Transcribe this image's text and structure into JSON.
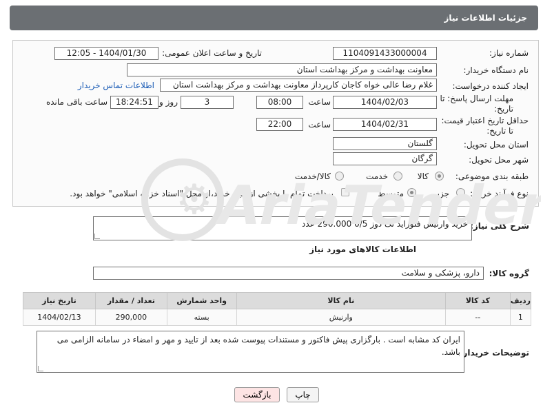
{
  "header": {
    "title": "جزئیات اطلاعات نیاز"
  },
  "form": {
    "need_number_label": "شماره نیاز:",
    "need_number": "1104091433000004",
    "announce_label": "تاریخ و ساعت اعلان عمومی:",
    "announce_value": "1404/01/30 - 12:05",
    "buyer_org_label": "نام دستگاه خریدار:",
    "buyer_org": "معاونت  بهداشت و مرکز بهداشت استان",
    "requester_label": "ایجاد کننده درخواست:",
    "requester": "غلام رضا عالی خواه کاجان کارپرداز معاونت  بهداشت و مرکز بهداشت استان",
    "buyer_contact_link": "اطلاعات تماس خریدار",
    "deadline_label_1": "مهلت ارسال پاسخ: تا",
    "deadline_label_2": "تاریخ:",
    "deadline_date": "1404/02/03",
    "time_label": "ساعت",
    "deadline_time": "08:00",
    "days_value": "3",
    "days_label": "روز و",
    "remaining_time": "18:24:51",
    "remaining_label": "ساعت باقی مانده",
    "price_valid_label_1": "حداقل تاریخ اعتبار قیمت:",
    "price_valid_label_2": "تا تاریخ:",
    "price_valid_date": "1404/02/31",
    "price_valid_time": "22:00",
    "province_label": "استان محل تحویل:",
    "province": "گلستان",
    "city_label": "شهر محل تحویل:",
    "city": "گرگان",
    "category_label": "طبقه بندی موضوعی:",
    "category_options": [
      "کالا",
      "خدمت",
      "کالا/خدمت"
    ],
    "process_label": "نوع فرآیند خرید :",
    "process_options": [
      "جزیی",
      "متوسط"
    ],
    "payment_note": "پرداخت تمام یا بخشی از مبلغ خرید،از محل \"اسناد خزانه اسلامی\" خواهد بود."
  },
  "description": {
    "label": "شرح کلی نیاز:",
    "text": "خرید وارنیش فلوراید تک دوز 0/5   290.000 عدد"
  },
  "goods": {
    "section_title": "اطلاعات کالاهای مورد نیاز",
    "group_label": "گروه کالا:",
    "group_value": "دارو، پزشکی و سلامت",
    "table": {
      "headers": [
        "ردیف",
        "کد کالا",
        "نام کالا",
        "واحد شمارش",
        "تعداد / مقدار",
        "تاریخ نیاز"
      ],
      "rows": [
        [
          "1",
          "--",
          "وارنیش",
          "بسته",
          "290,000",
          "1404/02/13"
        ]
      ]
    }
  },
  "buyer_notes": {
    "label": "توضیحات خریدار:",
    "text": "ایران کد مشابه است . بارگزاری پیش فاکتور و مستندات پیوست شده بعد از تایید و مهر و امضاء در سامانه الزامی می باشد."
  },
  "buttons": {
    "print": "چاپ",
    "back": "بازگشت"
  },
  "colors": {
    "header_bg": "#6b6f73",
    "link": "#1a5bb5",
    "back_button_bg": "#fde4e4"
  }
}
